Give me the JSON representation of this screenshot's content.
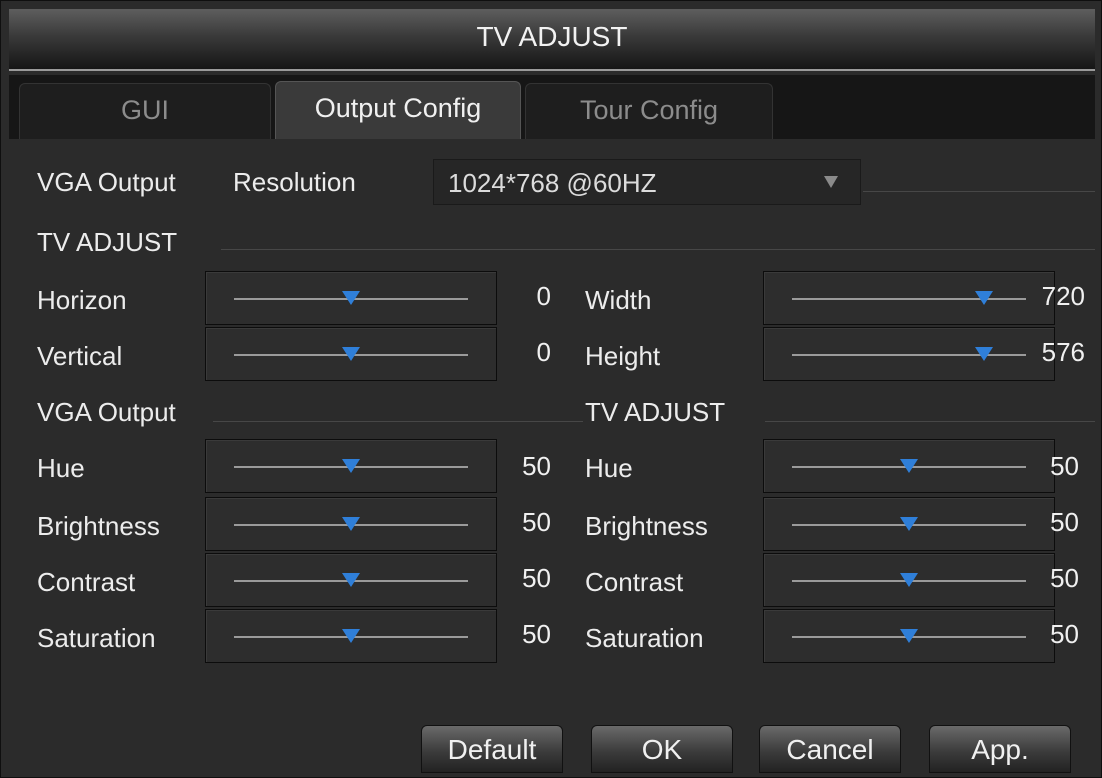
{
  "window": {
    "title": "TV ADJUST"
  },
  "tabs": [
    {
      "label": "GUI",
      "active": false
    },
    {
      "label": "Output Config",
      "active": true
    },
    {
      "label": "Tour Config",
      "active": false
    }
  ],
  "resolution": {
    "label_vga": "VGA Output",
    "label_res": "Resolution",
    "value": "1024*768 @60HZ",
    "icon": "dropdown-arrow-icon"
  },
  "tv_adjust_section": {
    "title": "TV ADJUST"
  },
  "position": {
    "horizon": {
      "label": "Horizon",
      "value": "0",
      "fraction": 0.5
    },
    "vertical": {
      "label": "Vertical",
      "value": "0",
      "fraction": 0.5
    },
    "width": {
      "label": "Width",
      "value": "720",
      "fraction": 0.82
    },
    "height": {
      "label": "Height",
      "value": "576",
      "fraction": 0.82
    }
  },
  "vga_output": {
    "title": "VGA Output",
    "hue": {
      "label": "Hue",
      "value": "50",
      "fraction": 0.5
    },
    "brightness": {
      "label": "Brightness",
      "value": "50",
      "fraction": 0.5
    },
    "contrast": {
      "label": "Contrast",
      "value": "50",
      "fraction": 0.5
    },
    "saturation": {
      "label": "Saturation",
      "value": "50",
      "fraction": 0.5
    }
  },
  "tv_adjust": {
    "title": "TV ADJUST",
    "hue": {
      "label": "Hue",
      "value": "50",
      "fraction": 0.5
    },
    "brightness": {
      "label": "Brightness",
      "value": "50",
      "fraction": 0.5
    },
    "contrast": {
      "label": "Contrast",
      "value": "50",
      "fraction": 0.5
    },
    "saturation": {
      "label": "Saturation",
      "value": "50",
      "fraction": 0.5
    }
  },
  "buttons": {
    "default": "Default",
    "ok": "OK",
    "cancel": "Cancel",
    "apply": "App."
  },
  "colors": {
    "accent": "#2f7fd9",
    "background": "#2b2b2b"
  }
}
